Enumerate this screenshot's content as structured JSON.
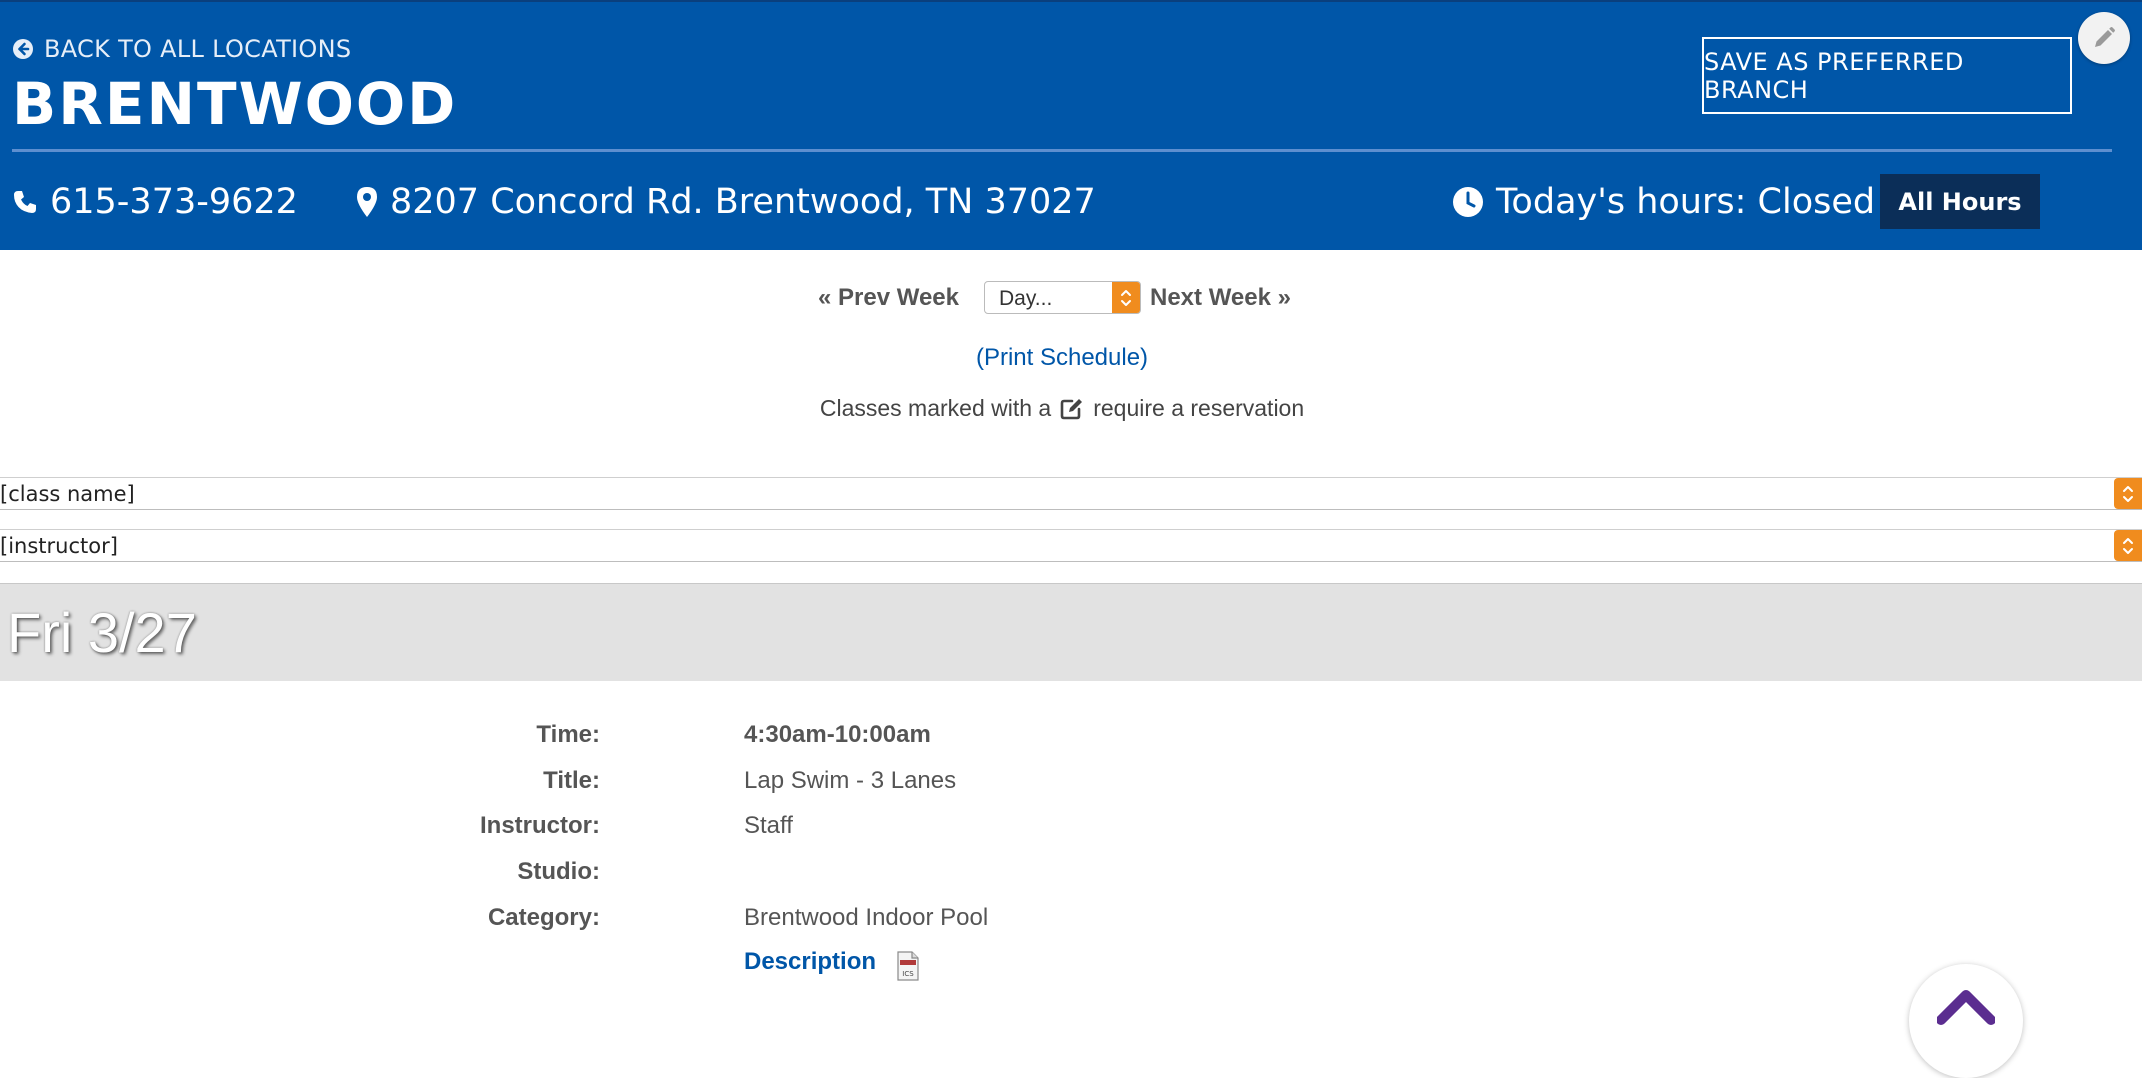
{
  "header": {
    "back_link": "BACK TO ALL LOCATIONS",
    "branch_name": "BRENTWOOD",
    "save_button": "SAVE AS PREFERRED BRANCH",
    "phone": "615-373-9622",
    "address": "8207 Concord Rd. Brentwood, TN 37027",
    "hours": "Today's hours: Closed",
    "all_hours_button": "All Hours",
    "brand_color": "#0056a8"
  },
  "schedule_nav": {
    "prev_week": "« Prev Week",
    "day_select": "Day...",
    "next_week": "Next Week »",
    "print_link": "(Print Schedule)",
    "reservation_note_before": "Classes marked with a",
    "reservation_note_after": "require a reservation"
  },
  "filters": {
    "class_name": "[class name]",
    "instructor": "[instructor]"
  },
  "day": {
    "label": "Fri 3/27"
  },
  "class_entry": {
    "time_label": "Time:",
    "time_value": "4:30am-10:00am",
    "title_label": "Title:",
    "title_value": "Lap Swim - 3 Lanes",
    "instructor_label": "Instructor:",
    "instructor_value": "Staff",
    "studio_label": "Studio:",
    "studio_value": "",
    "category_label": "Category:",
    "category_value": "Brentwood Indoor Pool",
    "description_link": "Description",
    "ics_icon_text": "ICS"
  },
  "icons": {
    "back": "circle-arrow-left-icon",
    "phone": "phone-icon",
    "location": "map-pin-icon",
    "clock": "clock-icon",
    "edit": "pencil-icon",
    "reservation": "edit-square-icon",
    "calendar_file": "ics-file-icon",
    "scroll_top": "arrow-up-icon"
  },
  "accent_colors": {
    "select_arrow": "#f08c1e",
    "all_hours_bg": "#0b2e58",
    "scroll_arrow": "#5b2d90"
  }
}
